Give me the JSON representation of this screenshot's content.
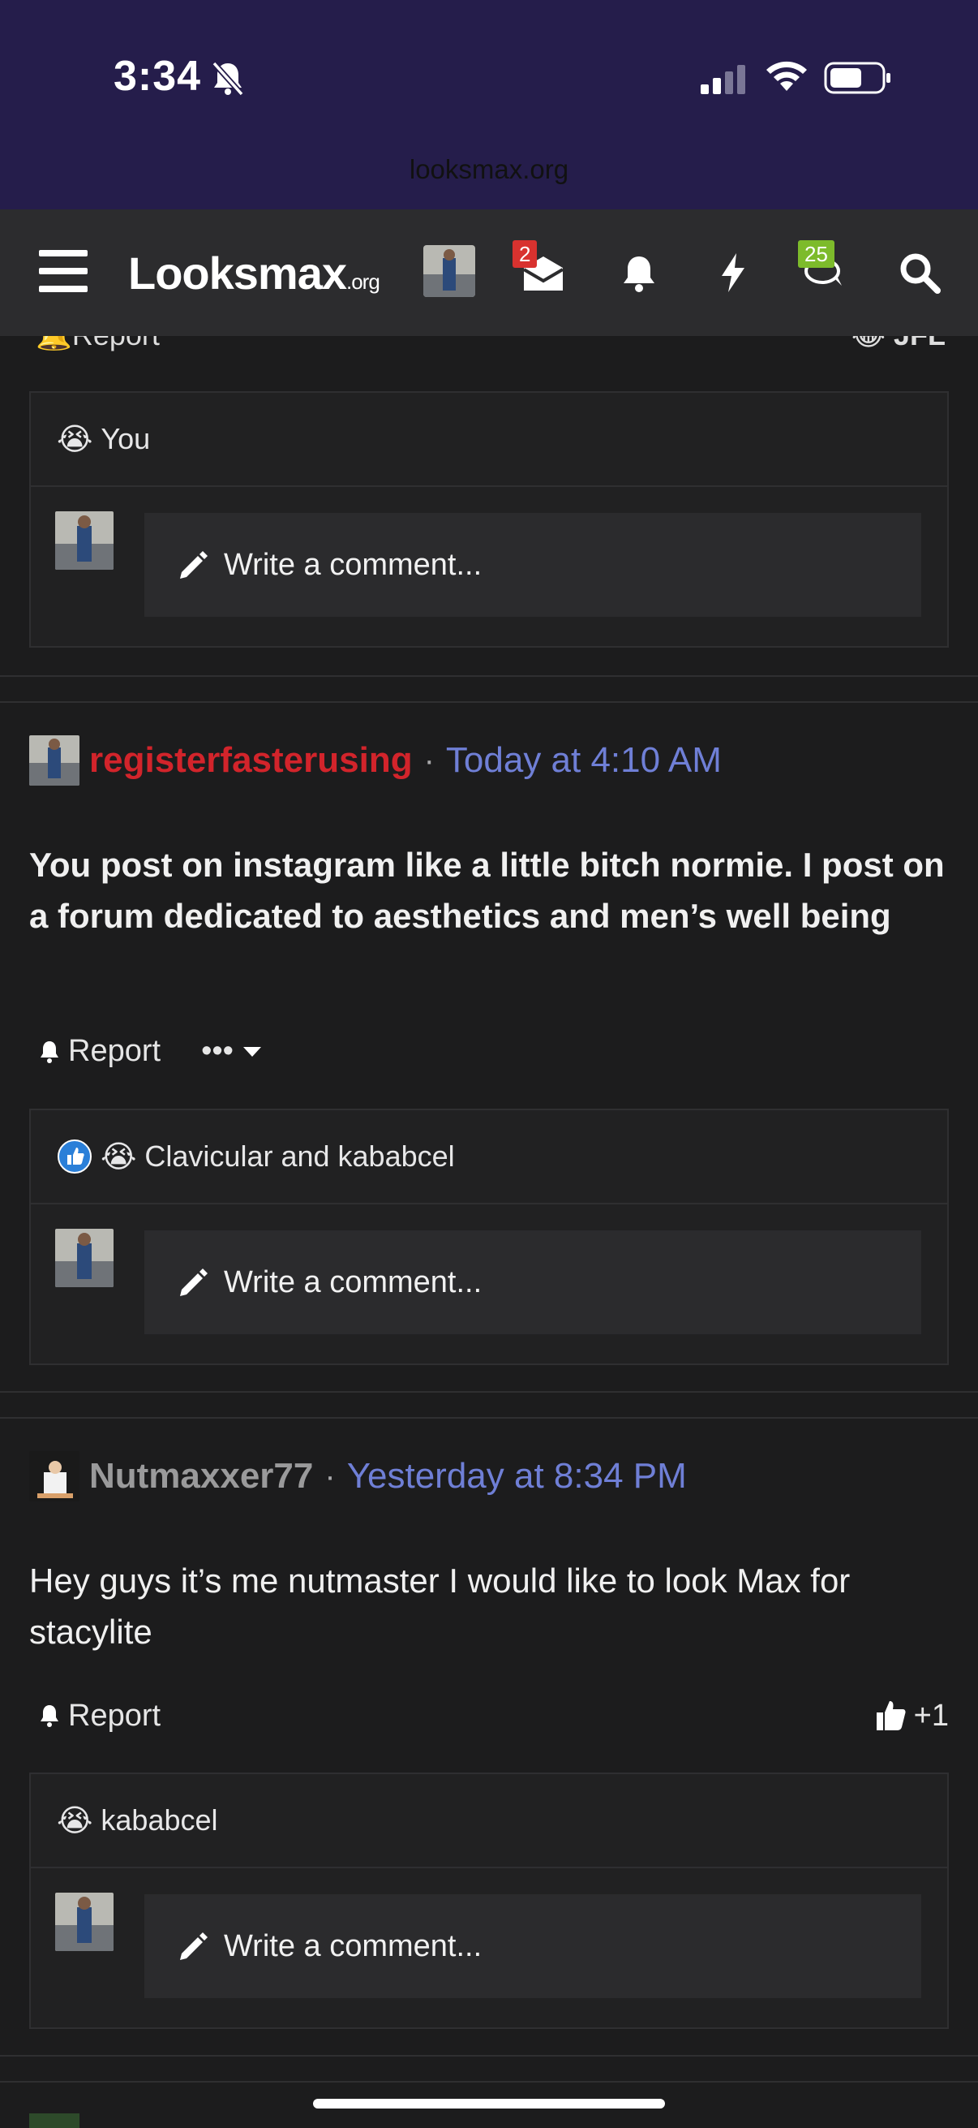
{
  "status_bar": {
    "time": "3:34",
    "url": "looksmax.org"
  },
  "nav": {
    "logo_main": "Looksmax",
    "logo_suffix": ".org",
    "inbox_badge": "2",
    "messages_badge": "25"
  },
  "partial_post": {
    "report_label": "Report",
    "reaction_label": "JFL"
  },
  "posts": [
    {
      "reaction_summary": "You",
      "comment_placeholder": "Write a comment..."
    },
    {
      "username": "registerfasterusing",
      "time": "Today at 4:10 AM",
      "body": "You post on instagram like a little bitch normie. I post on a forum dedicated to aesthetics and men’s well being",
      "report_label": "Report",
      "more_label": "•••",
      "reaction_summary": "Clavicular and kababcel",
      "comment_placeholder": "Write a comment..."
    },
    {
      "username": "Nutmaxxer77",
      "time": "Yesterday at 8:34 PM",
      "body": "Hey guys it’s me nutmaster I would like to look Max for stacylite",
      "report_label": "Report",
      "score": "+1",
      "reaction_summary": "kababcel",
      "comment_placeholder": "Write a comment..."
    }
  ],
  "colors": {
    "status_bg": "#251d4b",
    "nav_bg": "#2c2c2e",
    "username_red": "#d2242b",
    "time_blue": "#6f7fd6"
  }
}
